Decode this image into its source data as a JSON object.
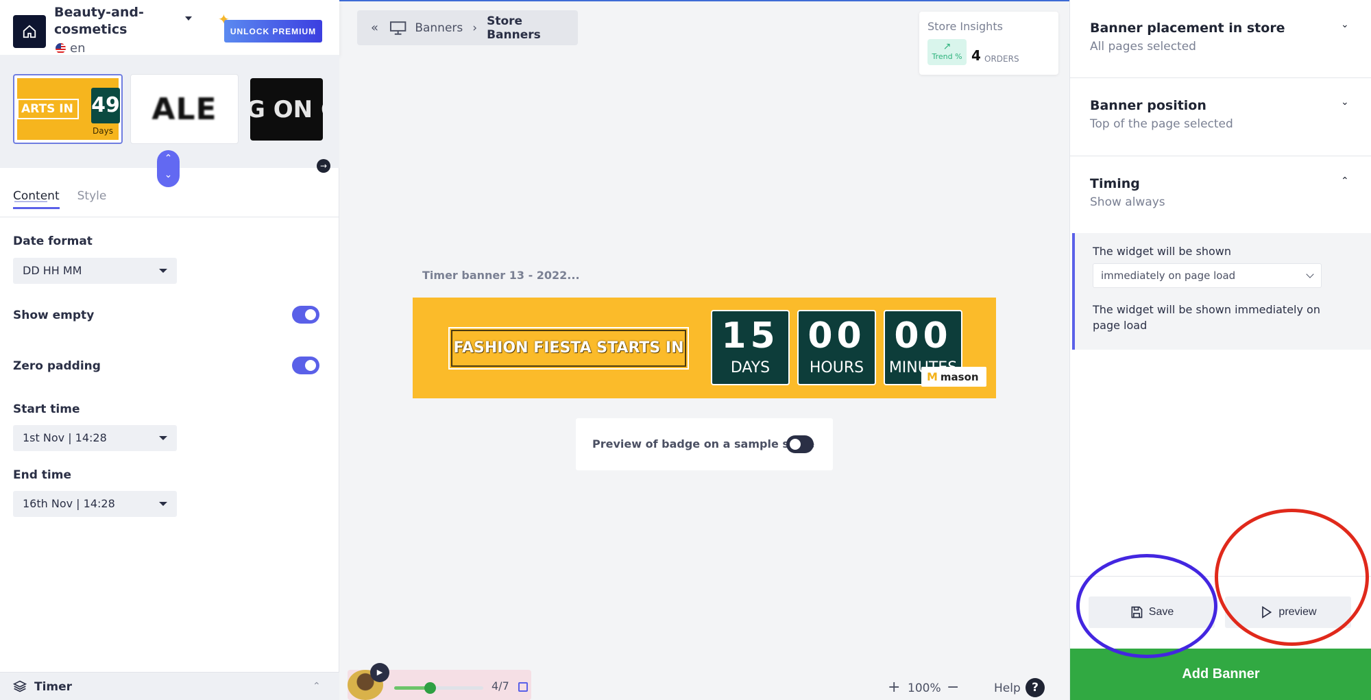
{
  "store": {
    "name": "Beauty-and-cosmetics",
    "language": "en",
    "unlock_label": "UNLOCK PREMIUM"
  },
  "thumbnails": [
    {
      "text": "ARTS IN",
      "number": "49",
      "unit": "Days"
    },
    {
      "text": "ALE"
    },
    {
      "text": "G ON C"
    }
  ],
  "tabs": {
    "content": "Content",
    "style": "Style"
  },
  "fields": {
    "date_format": {
      "label": "Date format",
      "value": "DD HH MM"
    },
    "show_empty": {
      "label": "Show empty",
      "on": true
    },
    "zero_padding": {
      "label": "Zero padding",
      "on": true
    },
    "start_time": {
      "label": "Start time",
      "value": "1st Nov | 14:28"
    },
    "end_time": {
      "label": "End time",
      "value": "16th Nov | 14:28"
    }
  },
  "left_footer": {
    "label": "Timer"
  },
  "breadcrumb": {
    "first": "Banners",
    "current": "Store Banners"
  },
  "insights": {
    "title": "Store Insights",
    "trend_label": "Trend %",
    "orders_value": "4",
    "orders_unit": "ORDERS"
  },
  "banner": {
    "name": "Timer banner 13 - 2022...",
    "headline": "FASHION FIESTA STARTS IN",
    "days_value": "15",
    "days_label": "DAYS",
    "hours_value": "00",
    "hours_label": "HOURS",
    "minutes_value": "00",
    "minutes_label": "MINUTES",
    "brand": "mason",
    "bg_color": "#fbbb2a"
  },
  "preview_badge": {
    "label": "Preview of badge on a sample store",
    "on": false
  },
  "player": {
    "count": "4/7",
    "progress": 0.4
  },
  "zoom": {
    "value": "100%"
  },
  "help_label": "Help",
  "right": {
    "placement": {
      "title": "Banner placement in store",
      "subtitle": "All pages selected"
    },
    "position": {
      "title": "Banner position",
      "subtitle": "Top of the page selected"
    },
    "timing": {
      "title": "Timing",
      "subtitle": "Show always",
      "shown_label": "The widget will be shown",
      "shown_value": "immediately on page load",
      "description": "The widget will be shown immediately on page load"
    },
    "save_label": "Save",
    "preview_label": "preview",
    "add_label": "Add Banner"
  },
  "colors": {
    "accent": "#5a60e8",
    "add_button": "#31a942",
    "annotation_blue": "#4326e0",
    "annotation_red": "#e0291b"
  }
}
